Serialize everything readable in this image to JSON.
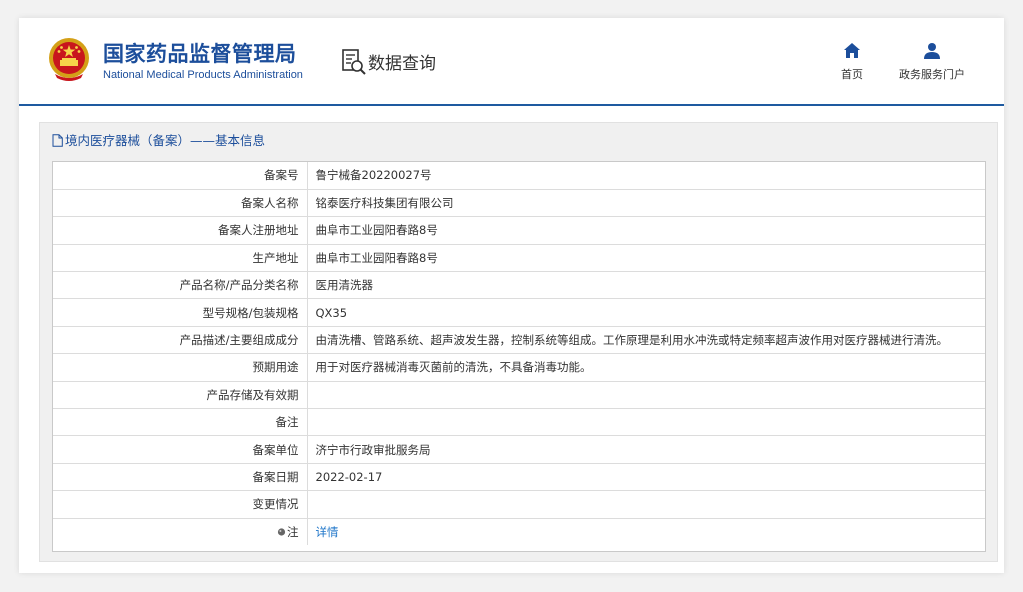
{
  "header": {
    "title_cn": "国家药品监督管理局",
    "title_en": "National Medical Products Administration",
    "query_label": "数据查询",
    "nav": [
      {
        "label": "首页",
        "icon": "home-icon"
      },
      {
        "label": "政务服务门户",
        "icon": "user-icon"
      }
    ]
  },
  "panel": {
    "title": "境内医疗器械（备案）——基本信息"
  },
  "rows": [
    {
      "label": "备案号",
      "value": "鲁宁械备20220027号"
    },
    {
      "label": "备案人名称",
      "value": "铭泰医疗科技集团有限公司"
    },
    {
      "label": "备案人注册地址",
      "value": "曲阜市工业园阳春路8号"
    },
    {
      "label": "生产地址",
      "value": "曲阜市工业园阳春路8号"
    },
    {
      "label": "产品名称/产品分类名称",
      "value": "医用清洗器"
    },
    {
      "label": "型号规格/包装规格",
      "value": "QX35"
    },
    {
      "label": "产品描述/主要组成成分",
      "value": "由清洗槽、管路系统、超声波发生器，控制系统等组成。工作原理是利用水冲洗或特定频率超声波作用对医疗器械进行清洗。"
    },
    {
      "label": "预期用途",
      "value": "用于对医疗器械消毒灭菌前的清洗，不具备消毒功能。"
    },
    {
      "label": "产品存储及有效期",
      "value": ""
    },
    {
      "label": "备注",
      "value": ""
    },
    {
      "label": "备案单位",
      "value": "济宁市行政审批服务局"
    },
    {
      "label": "备案日期",
      "value": "2022-02-17"
    },
    {
      "label": "变更情况",
      "value": ""
    }
  ],
  "note_row": {
    "label": "注",
    "link": "详情"
  },
  "colors": {
    "brand": "#1c4e9b",
    "link": "#1a73c8",
    "header_rule": "#1e5aa0"
  }
}
